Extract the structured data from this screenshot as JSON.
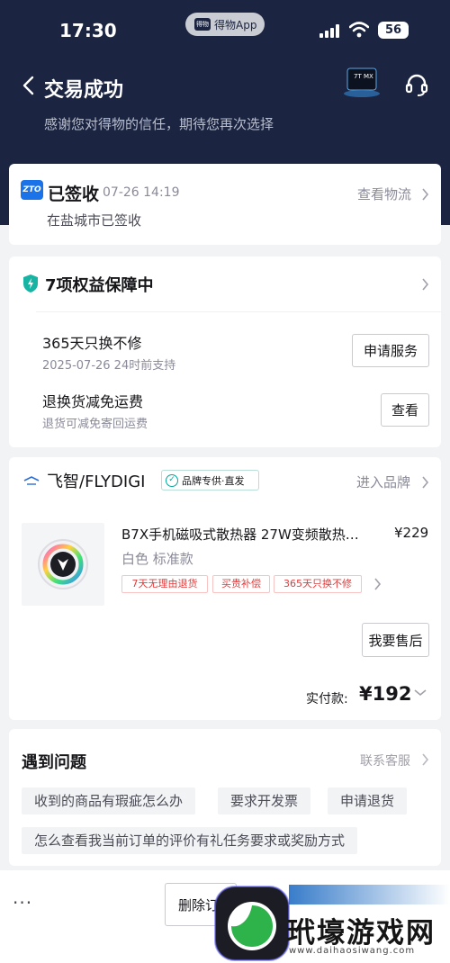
{
  "status_bar": {
    "time": "17:30",
    "app_pill": "得物App",
    "app_pill_icon": "得物",
    "battery": "56"
  },
  "nav": {
    "back_icon": "chevron-left-icon",
    "title": "交易成功",
    "subtitle": "感谢您对得物的信任，期待您再次选择",
    "thumb_label": "7T MX",
    "service_icon": "headset-icon"
  },
  "logistics": {
    "carrier_logo": "ZTO",
    "status": "已签收",
    "time": "07-26 14:19",
    "view_link": "查看物流",
    "location": "在盐城市已签收"
  },
  "rights": {
    "title": "7项权益保障中",
    "items": [
      {
        "title": "365天只换不修",
        "sub": "2025-07-26 24时前支持",
        "button": "申请服务"
      },
      {
        "title": "退换货减免运费",
        "sub": "退货可减免寄回运费",
        "button": "查看"
      }
    ]
  },
  "order": {
    "brand_name": "飞智/FLYDIGI",
    "brand_badge": "品牌专供·直发",
    "enter_brand": "进入品牌",
    "product_title": "B7X手机磁吸式散热器 27W变频散热…",
    "price": "¥229",
    "spec": "白色 标准款",
    "tags": [
      "7天无理由退货",
      "买贵补偿",
      "365天只换不修"
    ],
    "after_sale_button": "我要售后",
    "paid_label": "实付款:",
    "paid_amount": "¥192"
  },
  "faq": {
    "title": "遇到问题",
    "contact": "联系客服",
    "chips": [
      "收到的商品有瑕疵怎么办",
      "要求开发票",
      "申请退货",
      "怎么查看我当前订单的评价有礼任务要求或奖励方式"
    ]
  },
  "bottom_bar": {
    "more": "···",
    "delete_button": "删除订单"
  },
  "watermark": {
    "text_cn": "玳壕游戏网",
    "url": "www.daihaosiwang.com"
  },
  "colors": {
    "header_bg": "#1b2440",
    "accent_red": "#e23b3b",
    "badge_teal": "#00a69a",
    "zto_blue": "#1a73e8"
  }
}
